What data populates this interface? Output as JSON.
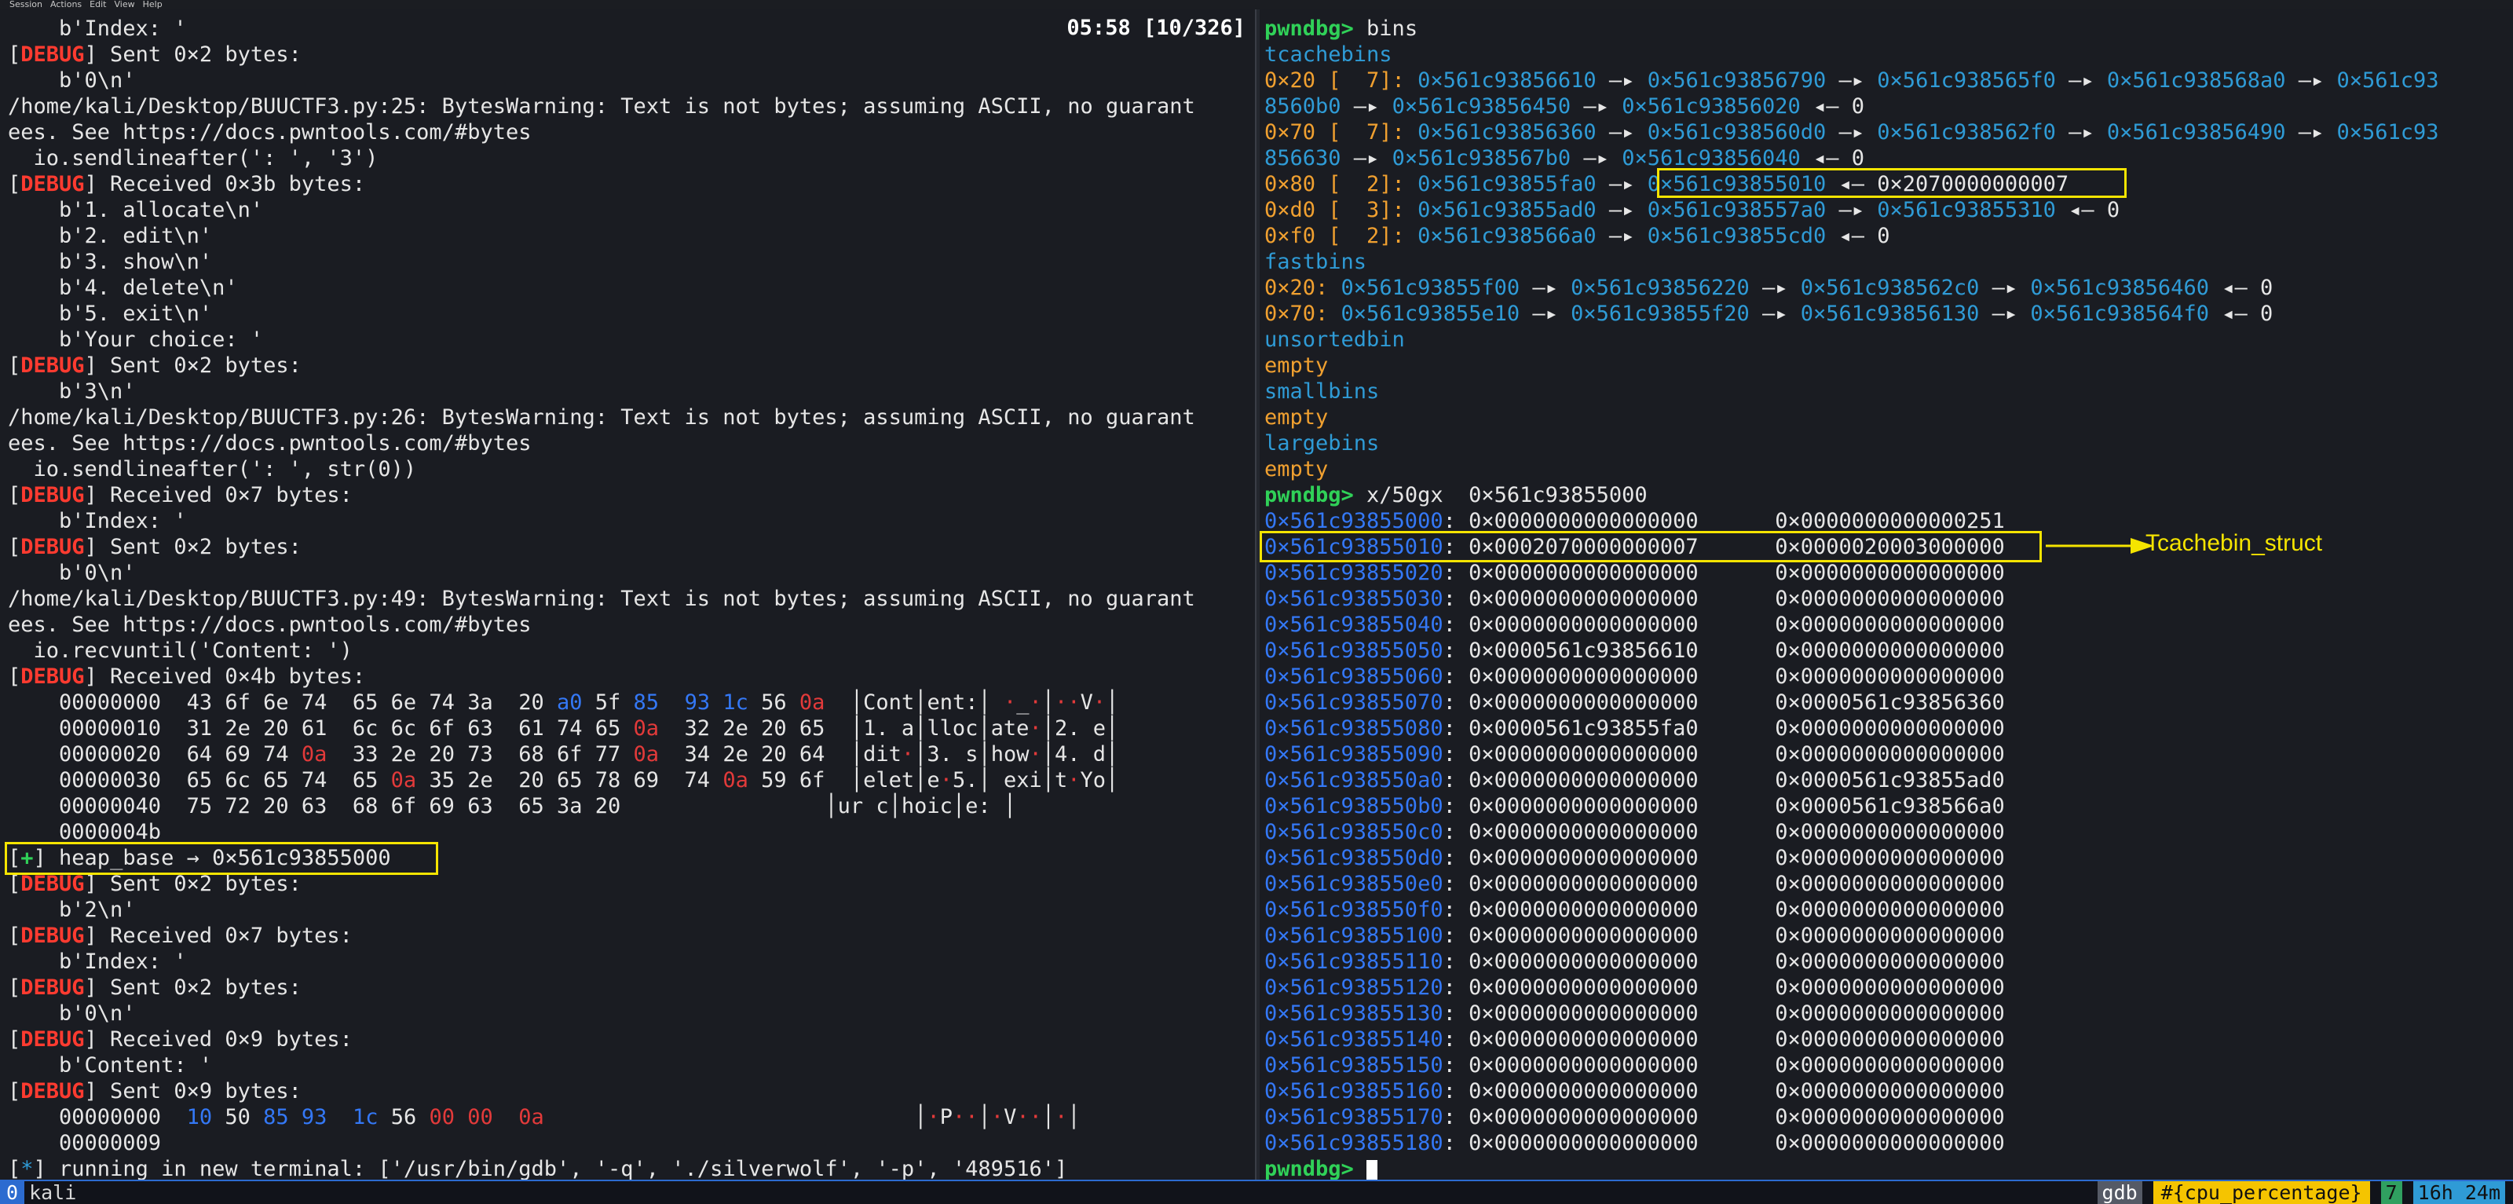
{
  "menubar": [
    "Session",
    "Actions",
    "Edit",
    "View",
    "Help"
  ],
  "left": {
    "clock": "05:58 [10/326]",
    "lines": [
      [
        [
          "white",
          "    b'Index: '"
        ]
      ],
      [
        [
          "white",
          "["
        ],
        [
          "red",
          "DEBUG"
        ],
        [
          "white",
          "] Sent 0×2 bytes:"
        ]
      ],
      [
        [
          "white",
          "    b'0\\n'"
        ]
      ],
      [
        [
          "white",
          "/home/kali/Desktop/BUUCTF3.py:25: BytesWarning: Text is not bytes; assuming ASCII, no guarant"
        ]
      ],
      [
        [
          "white",
          "ees. See https://docs.pwntools.com/#bytes"
        ]
      ],
      [
        [
          "white",
          "  io.sendlineafter(': ', '3')"
        ]
      ],
      [
        [
          "white",
          "["
        ],
        [
          "red",
          "DEBUG"
        ],
        [
          "white",
          "] Received 0×3b bytes:"
        ]
      ],
      [
        [
          "white",
          "    b'1. allocate\\n'"
        ]
      ],
      [
        [
          "white",
          "    b'2. edit\\n'"
        ]
      ],
      [
        [
          "white",
          "    b'3. show\\n'"
        ]
      ],
      [
        [
          "white",
          "    b'4. delete\\n'"
        ]
      ],
      [
        [
          "white",
          "    b'5. exit\\n'"
        ]
      ],
      [
        [
          "white",
          "    b'Your choice: '"
        ]
      ],
      [
        [
          "white",
          "["
        ],
        [
          "red",
          "DEBUG"
        ],
        [
          "white",
          "] Sent 0×2 bytes:"
        ]
      ],
      [
        [
          "white",
          "    b'3\\n'"
        ]
      ],
      [
        [
          "white",
          "/home/kali/Desktop/BUUCTF3.py:26: BytesWarning: Text is not bytes; assuming ASCII, no guarant"
        ]
      ],
      [
        [
          "white",
          "ees. See https://docs.pwntools.com/#bytes"
        ]
      ],
      [
        [
          "white",
          "  io.sendlineafter(': ', str(0))"
        ]
      ],
      [
        [
          "white",
          "["
        ],
        [
          "red",
          "DEBUG"
        ],
        [
          "white",
          "] Received 0×7 bytes:"
        ]
      ],
      [
        [
          "white",
          "    b'Index: '"
        ]
      ],
      [
        [
          "white",
          "["
        ],
        [
          "red",
          "DEBUG"
        ],
        [
          "white",
          "] Sent 0×2 bytes:"
        ]
      ],
      [
        [
          "white",
          "    b'0\\n'"
        ]
      ],
      [
        [
          "white",
          "/home/kali/Desktop/BUUCTF3.py:49: BytesWarning: Text is not bytes; assuming ASCII, no guarant"
        ]
      ],
      [
        [
          "white",
          "ees. See https://docs.pwntools.com/#bytes"
        ]
      ],
      [
        [
          "white",
          "  io.recvuntil('Content: ')"
        ]
      ],
      [
        [
          "white",
          "["
        ],
        [
          "red",
          "DEBUG"
        ],
        [
          "white",
          "] Received 0×4b bytes:"
        ]
      ],
      [
        [
          "white",
          "    00000000  43 6f 6e 74  65 6e 74 3a  20 "
        ],
        [
          "blue",
          "a0"
        ],
        [
          "white",
          " 5f "
        ],
        [
          "blue",
          "85"
        ],
        [
          "white",
          "  "
        ],
        [
          "blue",
          "93"
        ],
        [
          "white",
          " "
        ],
        [
          "blue",
          "1c"
        ],
        [
          "white",
          " 56 "
        ],
        [
          "redtxt",
          "0a"
        ],
        [
          "white",
          "  │Cont│ent:│ "
        ],
        [
          "redtxt",
          "·"
        ],
        [
          "white",
          "_"
        ],
        [
          "redtxt",
          "·"
        ],
        [
          "white",
          "│"
        ],
        [
          "redtxt",
          "··"
        ],
        [
          "white",
          "V"
        ],
        [
          "redtxt",
          "·"
        ],
        [
          "white",
          "│"
        ]
      ],
      [
        [
          "white",
          "    00000010  31 2e 20 61  6c 6c 6f 63  61 74 65 "
        ],
        [
          "redtxt",
          "0a"
        ],
        [
          "white",
          "  32 2e 20 65  │1. a│lloc│ate"
        ],
        [
          "redtxt",
          "·"
        ],
        [
          "white",
          "│2. e│"
        ]
      ],
      [
        [
          "white",
          "    00000020  64 69 74 "
        ],
        [
          "redtxt",
          "0a"
        ],
        [
          "white",
          "  33 2e 20 73  68 6f 77 "
        ],
        [
          "redtxt",
          "0a"
        ],
        [
          "white",
          "  34 2e 20 64  │dit"
        ],
        [
          "redtxt",
          "·"
        ],
        [
          "white",
          "│3. s│how"
        ],
        [
          "redtxt",
          "·"
        ],
        [
          "white",
          "│4. d│"
        ]
      ],
      [
        [
          "white",
          "    00000030  65 6c 65 74  65 "
        ],
        [
          "redtxt",
          "0a"
        ],
        [
          "white",
          " 35 2e  20 65 78 69  74 "
        ],
        [
          "redtxt",
          "0a"
        ],
        [
          "white",
          " 59 6f  │elet│e"
        ],
        [
          "redtxt",
          "·"
        ],
        [
          "white",
          "5.│ exi│t"
        ],
        [
          "redtxt",
          "·"
        ],
        [
          "white",
          "Yo│"
        ]
      ],
      [
        [
          "white",
          "    00000040  75 72 20 63  68 6f 69 63  65 3a 20                │ur c│hoic│e: │"
        ]
      ],
      [
        [
          "white",
          "    0000004b"
        ]
      ],
      [
        [
          "white",
          "["
        ],
        [
          "green",
          "+"
        ],
        [
          "white",
          "] heap_base → 0×561c93855000"
        ]
      ],
      [
        [
          "white",
          "["
        ],
        [
          "red",
          "DEBUG"
        ],
        [
          "white",
          "] Sent 0×2 bytes:"
        ]
      ],
      [
        [
          "white",
          "    b'2\\n'"
        ]
      ],
      [
        [
          "white",
          "["
        ],
        [
          "red",
          "DEBUG"
        ],
        [
          "white",
          "] Received 0×7 bytes:"
        ]
      ],
      [
        [
          "white",
          "    b'Index: '"
        ]
      ],
      [
        [
          "white",
          "["
        ],
        [
          "red",
          "DEBUG"
        ],
        [
          "white",
          "] Sent 0×2 bytes:"
        ]
      ],
      [
        [
          "white",
          "    b'0\\n'"
        ]
      ],
      [
        [
          "white",
          "["
        ],
        [
          "red",
          "DEBUG"
        ],
        [
          "white",
          "] Received 0×9 bytes:"
        ]
      ],
      [
        [
          "white",
          "    b'Content: '"
        ]
      ],
      [
        [
          "white",
          "["
        ],
        [
          "red",
          "DEBUG"
        ],
        [
          "white",
          "] Sent 0×9 bytes:"
        ]
      ],
      [
        [
          "white",
          "    00000000  "
        ],
        [
          "blue",
          "10"
        ],
        [
          "white",
          " 50 "
        ],
        [
          "blue",
          "85"
        ],
        [
          "white",
          " "
        ],
        [
          "blue",
          "93"
        ],
        [
          "white",
          "  "
        ],
        [
          "blue",
          "1c"
        ],
        [
          "white",
          " 56 "
        ],
        [
          "redtxt",
          "00"
        ],
        [
          "white",
          " "
        ],
        [
          "redtxt",
          "00"
        ],
        [
          "white",
          "  "
        ],
        [
          "redtxt",
          "0a"
        ],
        [
          "white",
          "                             │"
        ],
        [
          "redtxt",
          "·"
        ],
        [
          "white",
          "P"
        ],
        [
          "redtxt",
          "··"
        ],
        [
          "white",
          "│"
        ],
        [
          "redtxt",
          "·"
        ],
        [
          "white",
          "V"
        ],
        [
          "redtxt",
          "··"
        ],
        [
          "white",
          "│"
        ],
        [
          "redtxt",
          "·"
        ],
        [
          "white",
          "│"
        ]
      ],
      [
        [
          "white",
          "    00000009"
        ]
      ],
      [
        [
          "white",
          "["
        ],
        [
          "cyan",
          "*"
        ],
        [
          "white",
          "] running in new terminal: ['/usr/bin/gdb', '-q', './silverwolf', '-p', '489516']"
        ]
      ]
    ]
  },
  "right": {
    "lines": [
      [
        [
          "green",
          "pwndbg> "
        ],
        [
          "white",
          "bins"
        ]
      ],
      [
        [
          "cyan",
          "tcachebins"
        ]
      ],
      [
        [
          "orange",
          "0×20 [  7]: "
        ],
        [
          "cyan",
          "0×561c93856610"
        ],
        [
          "white",
          " —▸ "
        ],
        [
          "cyan",
          "0×561c93856790"
        ],
        [
          "white",
          " —▸ "
        ],
        [
          "cyan",
          "0×561c938565f0"
        ],
        [
          "white",
          " —▸ "
        ],
        [
          "cyan",
          "0×561c938568a0"
        ],
        [
          "white",
          " —▸ "
        ],
        [
          "cyan",
          "0×561c93"
        ]
      ],
      [
        [
          "cyan",
          "8560b0"
        ],
        [
          "white",
          " —▸ "
        ],
        [
          "cyan",
          "0×561c93856450"
        ],
        [
          "white",
          " —▸ "
        ],
        [
          "cyan",
          "0×561c93856020"
        ],
        [
          "white",
          " ◂— 0"
        ]
      ],
      [
        [
          "orange",
          "0×70 [  7]: "
        ],
        [
          "cyan",
          "0×561c93856360"
        ],
        [
          "white",
          " —▸ "
        ],
        [
          "cyan",
          "0×561c938560d0"
        ],
        [
          "white",
          " —▸ "
        ],
        [
          "cyan",
          "0×561c938562f0"
        ],
        [
          "white",
          " —▸ "
        ],
        [
          "cyan",
          "0×561c93856490"
        ],
        [
          "white",
          " —▸ "
        ],
        [
          "cyan",
          "0×561c93"
        ]
      ],
      [
        [
          "cyan",
          "856630"
        ],
        [
          "white",
          " —▸ "
        ],
        [
          "cyan",
          "0×561c938567b0"
        ],
        [
          "white",
          " —▸ "
        ],
        [
          "cyan",
          "0×561c93856040"
        ],
        [
          "white",
          " ◂— 0"
        ]
      ],
      [
        [
          "orange",
          "0×80 [  2]: "
        ],
        [
          "cyan",
          "0×561c93855fa0"
        ],
        [
          "white",
          " —▸ "
        ],
        [
          "cyan",
          "0×561c93855010"
        ],
        [
          "white",
          " ◂— 0×2070000000007"
        ]
      ],
      [
        [
          "orange",
          "0×d0 [  3]: "
        ],
        [
          "cyan",
          "0×561c93855ad0"
        ],
        [
          "white",
          " —▸ "
        ],
        [
          "cyan",
          "0×561c938557a0"
        ],
        [
          "white",
          " —▸ "
        ],
        [
          "cyan",
          "0×561c93855310"
        ],
        [
          "white",
          " ◂— 0"
        ]
      ],
      [
        [
          "orange",
          "0×f0 [  2]: "
        ],
        [
          "cyan",
          "0×561c938566a0"
        ],
        [
          "white",
          " —▸ "
        ],
        [
          "cyan",
          "0×561c93855cd0"
        ],
        [
          "white",
          " ◂— 0"
        ]
      ],
      [
        [
          "cyan",
          "fastbins"
        ]
      ],
      [
        [
          "orange",
          "0×20: "
        ],
        [
          "cyan",
          "0×561c93855f00"
        ],
        [
          "white",
          " —▸ "
        ],
        [
          "cyan",
          "0×561c93856220"
        ],
        [
          "white",
          " —▸ "
        ],
        [
          "cyan",
          "0×561c938562c0"
        ],
        [
          "white",
          " —▸ "
        ],
        [
          "cyan",
          "0×561c93856460"
        ],
        [
          "white",
          " ◂— 0"
        ]
      ],
      [
        [
          "orange",
          "0×70: "
        ],
        [
          "cyan",
          "0×561c93855e10"
        ],
        [
          "white",
          " —▸ "
        ],
        [
          "cyan",
          "0×561c93855f20"
        ],
        [
          "white",
          " —▸ "
        ],
        [
          "cyan",
          "0×561c93856130"
        ],
        [
          "white",
          " —▸ "
        ],
        [
          "cyan",
          "0×561c938564f0"
        ],
        [
          "white",
          " ◂— 0"
        ]
      ],
      [
        [
          "cyan",
          "unsortedbin"
        ]
      ],
      [
        [
          "orange",
          "empty"
        ]
      ],
      [
        [
          "cyan",
          "smallbins"
        ]
      ],
      [
        [
          "orange",
          "empty"
        ]
      ],
      [
        [
          "cyan",
          "largebins"
        ]
      ],
      [
        [
          "orange",
          "empty"
        ]
      ],
      [
        [
          "green",
          "pwndbg> "
        ],
        [
          "white",
          "x/50gx  0×561c93855000"
        ]
      ],
      [
        [
          "blue",
          "0×561c93855000"
        ],
        [
          "white",
          ": 0×0000000000000000      0×0000000000000251"
        ]
      ],
      [
        [
          "blue",
          "0×561c93855010"
        ],
        [
          "white",
          ": 0×0002070000000007      0×0000020003000000"
        ]
      ],
      [
        [
          "blue",
          "0×561c93855020"
        ],
        [
          "white",
          ": 0×0000000000000000      0×0000000000000000"
        ]
      ],
      [
        [
          "blue",
          "0×561c93855030"
        ],
        [
          "white",
          ": 0×0000000000000000      0×0000000000000000"
        ]
      ],
      [
        [
          "blue",
          "0×561c93855040"
        ],
        [
          "white",
          ": 0×0000000000000000      0×0000000000000000"
        ]
      ],
      [
        [
          "blue",
          "0×561c93855050"
        ],
        [
          "white",
          ": 0×0000561c93856610      0×0000000000000000"
        ]
      ],
      [
        [
          "blue",
          "0×561c93855060"
        ],
        [
          "white",
          ": 0×0000000000000000      0×0000000000000000"
        ]
      ],
      [
        [
          "blue",
          "0×561c93855070"
        ],
        [
          "white",
          ": 0×0000000000000000      0×0000561c93856360"
        ]
      ],
      [
        [
          "blue",
          "0×561c93855080"
        ],
        [
          "white",
          ": 0×0000561c93855fa0      0×0000000000000000"
        ]
      ],
      [
        [
          "blue",
          "0×561c93855090"
        ],
        [
          "white",
          ": 0×0000000000000000      0×0000000000000000"
        ]
      ],
      [
        [
          "blue",
          "0×561c938550a0"
        ],
        [
          "white",
          ": 0×0000000000000000      0×0000561c93855ad0"
        ]
      ],
      [
        [
          "blue",
          "0×561c938550b0"
        ],
        [
          "white",
          ": 0×0000000000000000      0×0000561c938566a0"
        ]
      ],
      [
        [
          "blue",
          "0×561c938550c0"
        ],
        [
          "white",
          ": 0×0000000000000000      0×0000000000000000"
        ]
      ],
      [
        [
          "blue",
          "0×561c938550d0"
        ],
        [
          "white",
          ": 0×0000000000000000      0×0000000000000000"
        ]
      ],
      [
        [
          "blue",
          "0×561c938550e0"
        ],
        [
          "white",
          ": 0×0000000000000000      0×0000000000000000"
        ]
      ],
      [
        [
          "blue",
          "0×561c938550f0"
        ],
        [
          "white",
          ": 0×0000000000000000      0×0000000000000000"
        ]
      ],
      [
        [
          "blue",
          "0×561c93855100"
        ],
        [
          "white",
          ": 0×0000000000000000      0×0000000000000000"
        ]
      ],
      [
        [
          "blue",
          "0×561c93855110"
        ],
        [
          "white",
          ": 0×0000000000000000      0×0000000000000000"
        ]
      ],
      [
        [
          "blue",
          "0×561c93855120"
        ],
        [
          "white",
          ": 0×0000000000000000      0×0000000000000000"
        ]
      ],
      [
        [
          "blue",
          "0×561c93855130"
        ],
        [
          "white",
          ": 0×0000000000000000      0×0000000000000000"
        ]
      ],
      [
        [
          "blue",
          "0×561c93855140"
        ],
        [
          "white",
          ": 0×0000000000000000      0×0000000000000000"
        ]
      ],
      [
        [
          "blue",
          "0×561c93855150"
        ],
        [
          "white",
          ": 0×0000000000000000      0×0000000000000000"
        ]
      ],
      [
        [
          "blue",
          "0×561c93855160"
        ],
        [
          "white",
          ": 0×0000000000000000      0×0000000000000000"
        ]
      ],
      [
        [
          "blue",
          "0×561c93855170"
        ],
        [
          "white",
          ": 0×0000000000000000      0×0000000000000000"
        ]
      ],
      [
        [
          "blue",
          "0×561c93855180"
        ],
        [
          "white",
          ": 0×0000000000000000      0×0000000000000000"
        ]
      ],
      [
        [
          "green",
          "pwndbg> "
        ]
      ]
    ],
    "annotation": "Tcachebin_struct"
  },
  "statusbar": {
    "tab_index": "0",
    "tab_name": "kali",
    "right_items": [
      "gdb",
      "#{cpu_percentage}",
      "7",
      "16h 24m"
    ]
  }
}
